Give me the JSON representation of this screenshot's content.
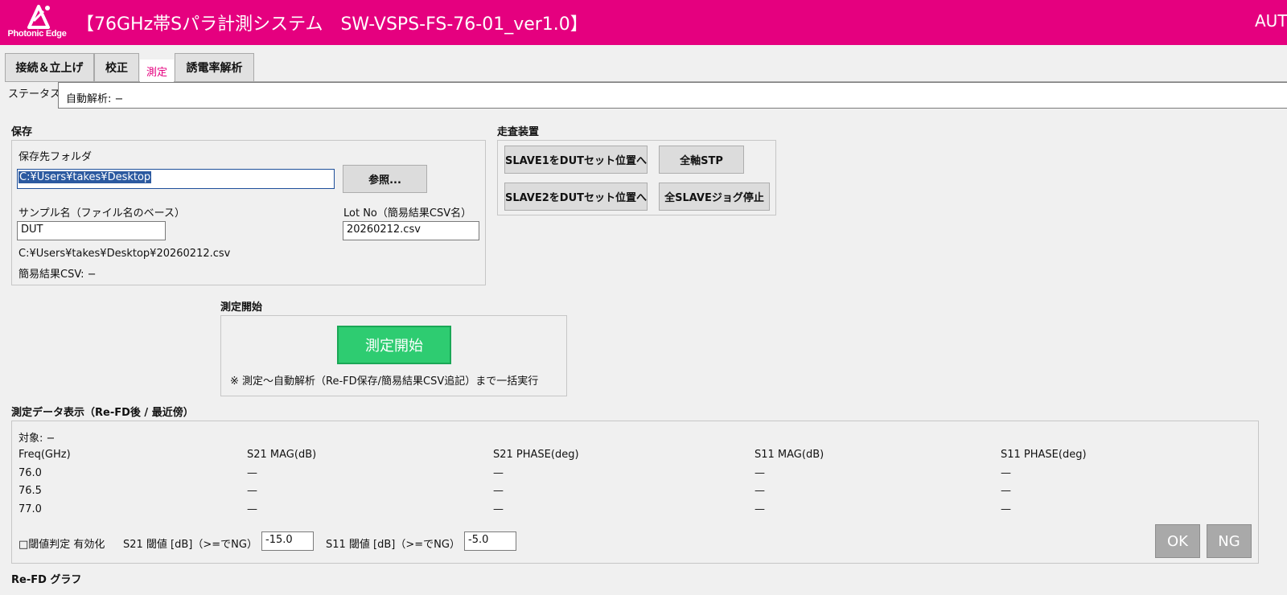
{
  "header": {
    "logo_text": "Photonic Edge",
    "title": "【76GHz帯Sパラ計測システム　SW-VSPS-FS-76-01_ver1.0】",
    "mode": "AUTO",
    "bg_color": "#e5007f"
  },
  "tabs": [
    {
      "label": "接続＆立上げ"
    },
    {
      "label": "校正"
    },
    {
      "label": "測定"
    },
    {
      "label": "誘電率解析"
    }
  ],
  "status": {
    "label": "ステータス",
    "value": "自動解析: −"
  },
  "save": {
    "section_title": "保存",
    "folder_label": "保存先フォルダ",
    "folder_value": "C:¥Users¥takes¥Desktop",
    "browse_label": "参照...",
    "sample_label": "サンプル名（ファイル名のベース）",
    "sample_value": "DUT",
    "lot_label": "Lot No（簡易結果CSV名）",
    "lot_value": "20260212.csv",
    "path_text": "C:¥Users¥takes¥Desktop¥20260212.csv",
    "csv_text": "簡易結果CSV: −"
  },
  "scanner": {
    "section_title": "走査装置",
    "slave1_label": "SLAVE1をDUTセット位置へ",
    "all_stp_label": "全軸STP",
    "slave2_label": "SLAVE2をDUTセット位置へ",
    "jog_stop_label": "全SLAVEジョグ停止"
  },
  "start": {
    "section_title": "測定開始",
    "button_label": "測定開始",
    "note": "※ 測定〜自動解析（Re-FD保存/簡易結果CSV追記）まで一括実行",
    "button_color": "#2ecc71"
  },
  "data_view": {
    "section_title": "測定データ表示（Re-FD後 / 最近傍）",
    "target": "対象: −",
    "headers": [
      "Freq(GHz)",
      "S21 MAG(dB)",
      "S21 PHASE(deg)",
      "S11 MAG(dB)",
      "S11 PHASE(deg)"
    ],
    "rows": [
      [
        "76.0",
        "—",
        "—",
        "—",
        "—"
      ],
      [
        "76.5",
        "—",
        "—",
        "—",
        "—"
      ],
      [
        "77.0",
        "—",
        "—",
        "—",
        "—"
      ]
    ],
    "threshold_label": "□閾値判定 有効化",
    "s21_label": "S21 閾値 [dB]（>=でNG）",
    "s21_value": "-15.0",
    "s11_label": "S11 閾値 [dB]（>=でNG）",
    "s11_value": "-5.0",
    "ok_label": "OK",
    "ng_label": "NG"
  },
  "graph": {
    "section_title": "Re-FD グラフ"
  }
}
